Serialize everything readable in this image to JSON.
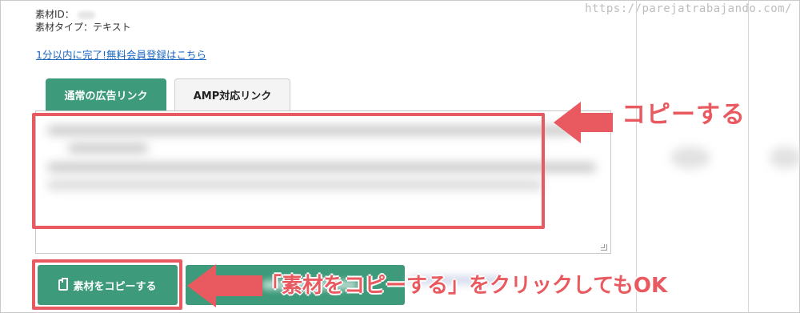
{
  "watermark": "https://parejatrabajando.com/",
  "material": {
    "id_label": "素材ID：",
    "type_label": "素材タイプ：テキスト"
  },
  "register_link": "1分以内に完了!無料会員登録はこちら",
  "tabs": [
    {
      "label": "通常の広告リンク",
      "active": true
    },
    {
      "label": "AMP対応リンク",
      "active": false
    }
  ],
  "buttons": {
    "copy_material": "素材をコピーする"
  },
  "annotations": {
    "copy": "コピーする",
    "click_copy": "「素材をコピーする」をクリックしてもOK"
  },
  "colors": {
    "accent_green": "#3d9a7a",
    "annotation_red": "#e85a5f",
    "link_blue": "#1a66c2"
  },
  "icons": {
    "copy_button_icon": "clipboard-icon",
    "annotation_arrows": [
      "arrow-right-icon",
      "arrow-left-icon"
    ]
  }
}
